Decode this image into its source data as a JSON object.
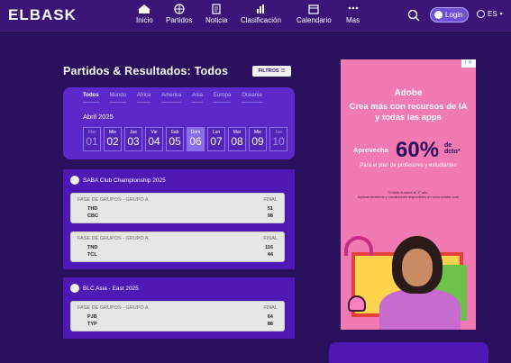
{
  "header": {
    "logo": "ELBASK",
    "nav": [
      {
        "label": "Inicio",
        "icon": "home-icon"
      },
      {
        "label": "Partidos",
        "icon": "basketball-icon"
      },
      {
        "label": "Noticia",
        "icon": "news-icon"
      },
      {
        "label": "Clasificación",
        "icon": "bar-chart-icon"
      },
      {
        "label": "Calendario",
        "icon": "calendar-icon"
      },
      {
        "label": "Mas",
        "icon": "more-dots-icon"
      }
    ],
    "login_label": "Login",
    "language": "ES"
  },
  "page": {
    "title": "Partidos & Resultados: Todos",
    "filter_button": "FILTROS"
  },
  "date_selector": {
    "tabs": [
      "Todos",
      "Mundo",
      "Africa",
      "America",
      "Asia",
      "Europa",
      "Oceania"
    ],
    "active_tab": "Todos",
    "month": "Abril 2025",
    "days": [
      {
        "name": "Mar",
        "num": "01",
        "state": "dim"
      },
      {
        "name": "Mie",
        "num": "02",
        "state": "normal"
      },
      {
        "name": "Jue",
        "num": "03",
        "state": "normal"
      },
      {
        "name": "Vie",
        "num": "04",
        "state": "normal"
      },
      {
        "name": "Sab",
        "num": "05",
        "state": "normal"
      },
      {
        "name": "Dom",
        "num": "06",
        "state": "selected"
      },
      {
        "name": "Lun",
        "num": "07",
        "state": "normal"
      },
      {
        "name": "Mar",
        "num": "08",
        "state": "normal"
      },
      {
        "name": "Mie",
        "num": "09",
        "state": "normal"
      },
      {
        "name": "Jue",
        "num": "10",
        "state": "dim"
      }
    ]
  },
  "competitions": [
    {
      "name": "SABA Club Championship 2025",
      "matches": [
        {
          "phase": "FASE DE GRUPOS - GRUPO A",
          "status": "FINAL",
          "team1": "THD",
          "score1": "51",
          "team2": "CBC",
          "score2": "98"
        },
        {
          "phase": "FASE DE GRUPOS - GRUPO A",
          "status": "FINAL",
          "team1": "TND",
          "score1": "116",
          "team2": "TCL",
          "score2": "44"
        }
      ]
    },
    {
      "name": "BLC Asia - East 2025",
      "matches": [
        {
          "phase": "FASE DE GRUPOS - GRUPO A",
          "status": "FINAL",
          "team1": "PJB",
          "score1": "64",
          "team2": "TYP",
          "score2": "88"
        }
      ]
    }
  ],
  "ad": {
    "brand": "Adobe",
    "headline": "Crea más con recursos de IA y todas las apps",
    "offer_prefix": "Aprovecha",
    "offer_percent": "60%",
    "offer_suffix_1": "de",
    "offer_suffix_2": "dcto*",
    "subtext": "Para el plan de profesores y estudiantes",
    "legal_1": "*Válido durante el 1º año.",
    "legal_2": "Aplican términos y condiciones disponibles en www.adobe.com",
    "info_badge": "i ✕",
    "colors": {
      "background": "#f27ab3",
      "accent": "#2a0f5c"
    }
  }
}
